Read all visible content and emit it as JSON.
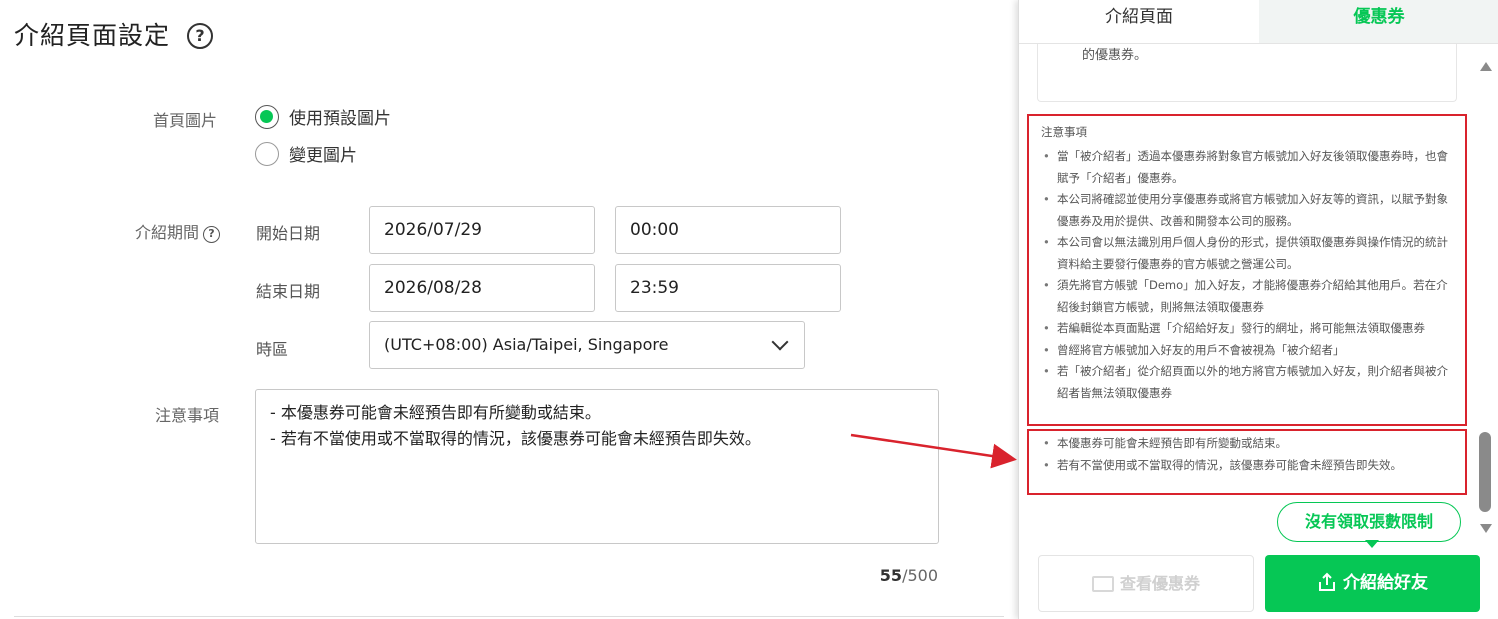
{
  "page": {
    "title": "介紹頁面設定",
    "help_icon": "question-circle-icon"
  },
  "form": {
    "cover_image_label": "首頁圖片",
    "cover_options": [
      {
        "label": "使用預設圖片",
        "checked": true
      },
      {
        "label": "變更圖片",
        "checked": false
      }
    ],
    "period_label": "介紹期間",
    "start_label": "開始日期",
    "start_date": "2026/07/29",
    "start_time": "00:00",
    "end_label": "結束日期",
    "end_date": "2026/08/28",
    "end_time": "23:59",
    "timezone_label": "時區",
    "timezone_value": "(UTC+08:00) Asia/Taipei, Singapore",
    "notes_label": "注意事項",
    "notes_lines": [
      "- 本優惠券可能會未經預告即有所變動或結束。",
      "- 若有不當使用或不當取得的情況，該優惠券可能會未經預告即失效。"
    ],
    "char_count": "55",
    "char_max": "/500"
  },
  "preview": {
    "tabs": [
      {
        "label": "介紹頁面",
        "active": true
      },
      {
        "label": "優惠券",
        "active": false
      }
    ],
    "card_tail_text": "的優惠券。",
    "notes_title": "注意事項",
    "notes_items": [
      "當「被介紹者」透過本優惠券將對象官方帳號加入好友後領取優惠券時，也會賦予「介紹者」優惠券。",
      "本公司將確認並使用分享優惠券或將官方帳號加入好友等的資訊，以賦予對象優惠券及用於提供、改善和開發本公司的服務。",
      "本公司會以無法識別用戶個人身份的形式，提供領取優惠券與操作情況的統計資料給主要發行優惠券的官方帳號之營運公司。",
      "須先將官方帳號「Demo」加入好友，才能將優惠券介紹給其他用戶。若在介紹後封鎖官方帳號，則將無法領取優惠券",
      "若編輯從本頁面點選「介紹給好友」發行的網址，將可能無法領取優惠券",
      "曾經將官方帳號加入好友的用戶不會被視為「被介紹者」",
      "若「被介紹者」從介紹頁面以外的地方將官方帳號加入好友，則介紹者與被介紹者皆無法領取優惠券"
    ],
    "custom_notes_items": [
      "本優惠券可能會未經預告即有所變動或結束。",
      "若有不當使用或不當取得的情況，該優惠券可能會未經預告即失效。"
    ],
    "bubble_text": "沒有領取張數限制",
    "view_button": "查看優惠券",
    "share_button": "介紹給好友"
  },
  "colors": {
    "accent": "#06c755",
    "highlight": "#d9232d"
  }
}
